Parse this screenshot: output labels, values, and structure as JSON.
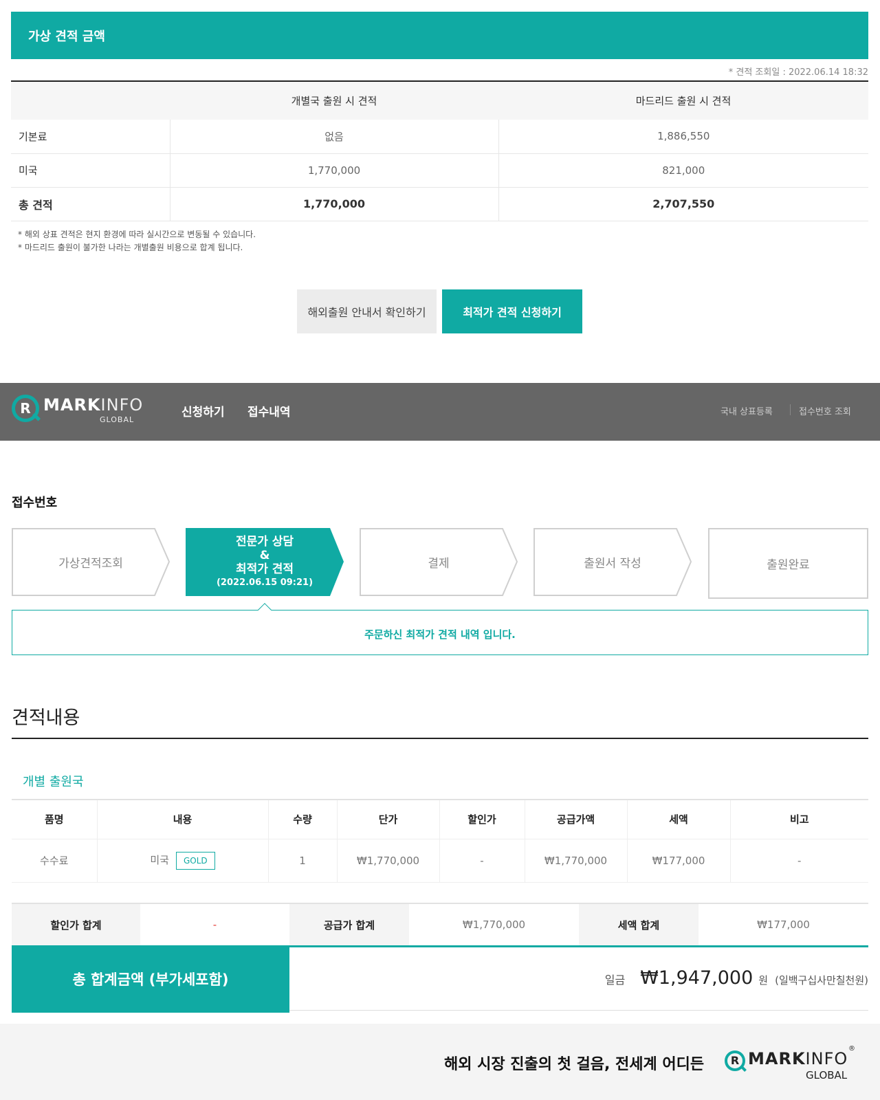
{
  "estimate": {
    "header": "가상 견적 금액",
    "date": "* 견적 조회일 : 2022.06.14 18:32",
    "columns": [
      "개별국 출원 시 견적",
      "마드리드 출원 시 견적"
    ],
    "rows": [
      {
        "label": "기본료",
        "individual": "없음",
        "madrid": "1,886,550"
      },
      {
        "label": "미국",
        "individual": "1,770,000",
        "madrid": "821,000"
      },
      {
        "label": "총 견적",
        "individual": "1,770,000",
        "madrid": "2,707,550"
      }
    ],
    "notes": [
      "* 해외 상표 견적은 현지 환경에 따라 실시간으로 변동될 수 있습니다.",
      "* 마드리드 출원이 불가한 나라는 개별출원 비용으로 합계 됩니다."
    ],
    "btn_guide": "해외출원 안내서 확인하기",
    "btn_request": "최적가 견적 신청하기"
  },
  "nav": {
    "logo_bold": "MARK",
    "logo_light": "INFO",
    "logo_r": "R",
    "logo_sub": "GLOBAL",
    "links": [
      "신청하기",
      "접수내역"
    ],
    "utils": [
      "국내 상표등록",
      "접수번호 조회"
    ]
  },
  "receipt": {
    "title": "접수번호",
    "steps": [
      {
        "label": "가상견적조회"
      },
      {
        "line1": "전문가 상담",
        "line2": "&",
        "line3": "최적가 견적",
        "date": "(2022.06.15 09:21)"
      },
      {
        "label": "결제"
      },
      {
        "label": "출원서 작성"
      },
      {
        "label": "출원완료"
      }
    ],
    "message": "주문하신 최적가 견적 내역 입니다."
  },
  "detail": {
    "title": "견적내용",
    "subtitle": "개별 출원국",
    "headers": [
      "품명",
      "내용",
      "수량",
      "단가",
      "할인가",
      "공급가액",
      "세액",
      "비고"
    ],
    "row": {
      "name": "수수료",
      "content": "미국",
      "badge": "GOLD",
      "qty": "1",
      "unit": "₩1,770,000",
      "discount": "-",
      "supply": "₩1,770,000",
      "tax": "₩177,000",
      "note": "-"
    },
    "summary": {
      "discount_label": "할인가 합계",
      "discount_value": "-",
      "supply_label": "공급가 합계",
      "supply_value": "₩1,770,000",
      "tax_label": "세액 합계",
      "tax_value": "₩177,000"
    },
    "total": {
      "label": "총 합계금액 (부가세포함)",
      "prefix": "일금",
      "amount": "₩1,947,000",
      "unit": "원",
      "korean": "(일백구십사만칠천원)"
    }
  },
  "footer": {
    "slogan": "해외 시장 진출의 첫 걸음, 전세계 어디든",
    "logo_bold": "MARK",
    "logo_light": "INFO",
    "logo_r": "R",
    "logo_sub": "GLOBAL",
    "reg": "®"
  },
  "colors": {
    "accent": "#10aaa3",
    "nav": "#666666",
    "footer_bg": "#f4f4f4"
  }
}
